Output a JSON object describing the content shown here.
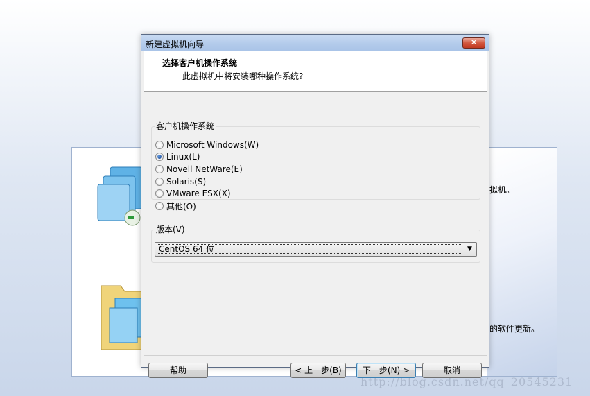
{
  "background_window": {
    "text_right_1": "拟机。",
    "text_right_2": "的软件更新。"
  },
  "watermark": "http://blog.csdn.net/qq_20545231",
  "dialog": {
    "title": "新建虚拟机向导",
    "close_label": "✕",
    "header": {
      "title": "选择客户机操作系统",
      "subtitle": "此虚拟机中将安装哪种操作系统?"
    },
    "os_group": {
      "label": "客户机操作系统",
      "options": [
        {
          "label": "Microsoft Windows(W)",
          "selected": false
        },
        {
          "label": "Linux(L)",
          "selected": true
        },
        {
          "label": "Novell NetWare(E)",
          "selected": false
        },
        {
          "label": "Solaris(S)",
          "selected": false
        },
        {
          "label": "VMware ESX(X)",
          "selected": false
        },
        {
          "label": "其他(O)",
          "selected": false
        }
      ]
    },
    "version_group": {
      "label": "版本(V)",
      "selected": "CentOS 64 位"
    },
    "buttons": {
      "help": "帮助",
      "back": "< 上一步(B)",
      "next": "下一步(N) >",
      "cancel": "取消"
    }
  }
}
